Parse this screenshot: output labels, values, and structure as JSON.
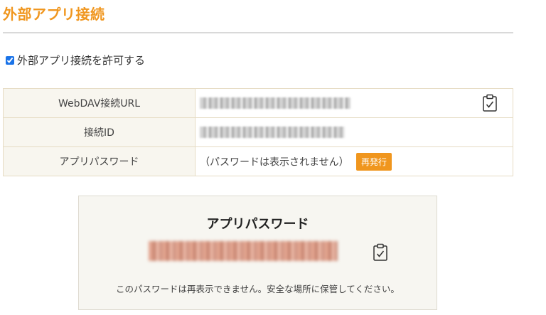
{
  "page": {
    "title": "外部アプリ接続",
    "allow_label": "外部アプリ接続を許可する",
    "allow_checked": true
  },
  "connection_table": {
    "rows": [
      {
        "label": "WebDAV接続URL",
        "value_state": "masked",
        "copy_icon": "clipboard-check-icon"
      },
      {
        "label": "接続ID",
        "value_state": "masked"
      },
      {
        "label": "アプリパスワード",
        "value_text": "（パスワードは表示されません）",
        "button_label": "再発行"
      }
    ]
  },
  "password_panel": {
    "title": "アプリパスワード",
    "value_state": "masked",
    "copy_icon": "clipboard-check-icon",
    "note": "このパスワードは再表示できません。安全な場所に保管してください。"
  },
  "colors": {
    "accent": "#f0961e",
    "label_bg": "#f8f6ef",
    "panel_bg": "#f7f6f1",
    "border": "#e6dcc4"
  }
}
